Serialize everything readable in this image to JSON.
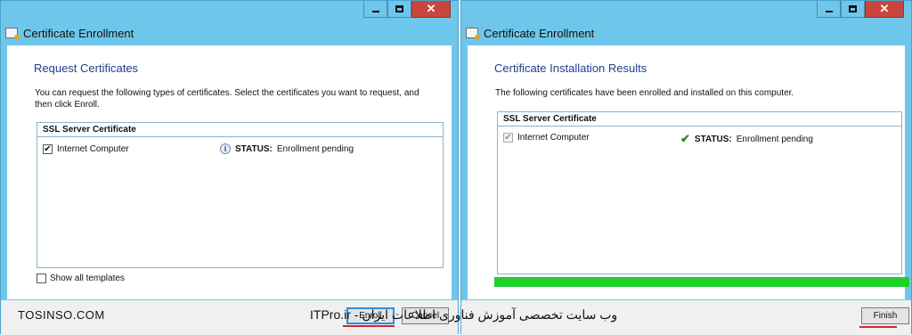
{
  "left_window": {
    "title": "Certificate Enrollment",
    "heading": "Request Certificates",
    "description": "You can request the following types of certificates. Select the certificates you want to request, and then click Enroll.",
    "cert_group_header": "SSL Server Certificate",
    "cert_item_label": "Internet Computer",
    "cert_item_checked": true,
    "status_label": "STATUS:",
    "status_value": "Enrollment pending",
    "status_icon": "info-icon",
    "show_all_label": "Show all templates",
    "enroll_button": "Enroll",
    "cancel_button": "Cancel"
  },
  "right_window": {
    "title": "Certificate Enrollment",
    "heading": "Certificate Installation Results",
    "description": "The following certificates have been enrolled and installed on this computer.",
    "cert_group_header": "SSL Server Certificate",
    "cert_item_label": "Internet Computer",
    "status_label": "STATUS:",
    "status_value": "Enrollment pending",
    "status_icon": "checkmark-icon",
    "progress_percent": 100,
    "finish_button": "Finish"
  },
  "watermarks": {
    "left": "TOSINSO.COM",
    "middle": "ITPro.ir - وب سایت تخصصی آموزش فناوری اطلاعات ایران"
  },
  "colors": {
    "window_frame": "#6ec6ea",
    "close_button": "#c9463d",
    "heading": "#1e3f8a",
    "progress": "#1fcf2d",
    "annotation_underline": "#d4242f"
  }
}
